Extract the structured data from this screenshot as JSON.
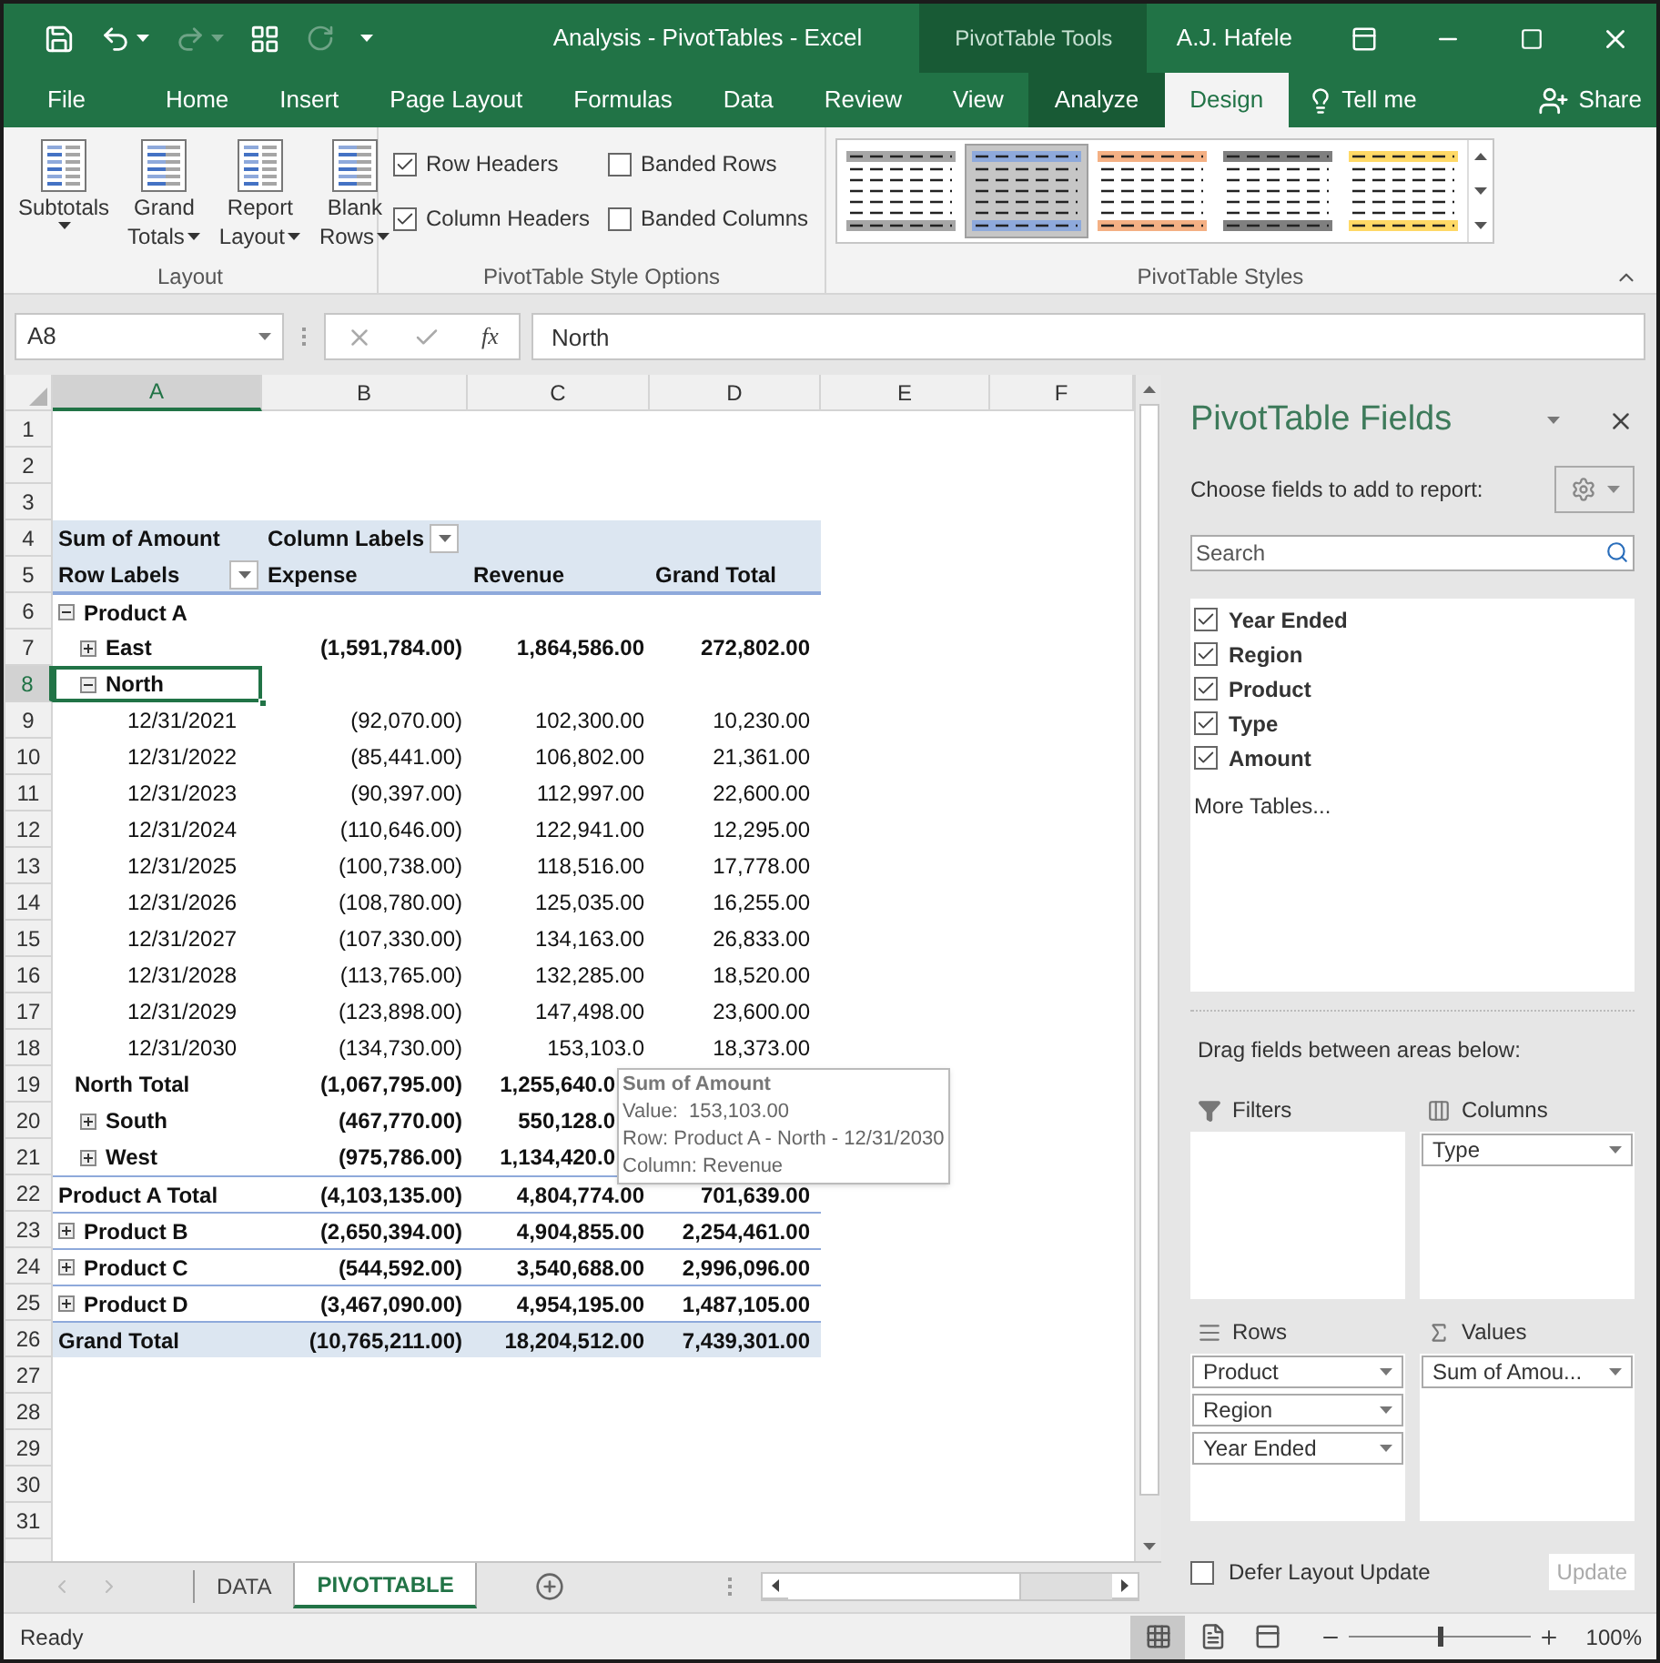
{
  "window": {
    "title": "Analysis - PivotTables  -  Excel",
    "context_group": "PivotTable Tools",
    "user": "A.J. Hafele"
  },
  "quick_access": [
    {
      "kind": "save",
      "disabled": false
    },
    {
      "kind": "undo",
      "disabled": false
    },
    {
      "kind": "redo",
      "disabled": true
    },
    {
      "kind": "form",
      "disabled": false
    },
    {
      "kind": "refresh",
      "disabled": true
    },
    {
      "kind": "customize",
      "disabled": false
    }
  ],
  "ribbon_tabs": [
    {
      "label": "File",
      "selected": false
    },
    {
      "label": "Home",
      "selected": false
    },
    {
      "label": "Insert",
      "selected": false
    },
    {
      "label": "Page Layout",
      "selected": false
    },
    {
      "label": "Formulas",
      "selected": false
    },
    {
      "label": "Data",
      "selected": false
    },
    {
      "label": "Review",
      "selected": false
    },
    {
      "label": "View",
      "selected": false
    }
  ],
  "context_tabs": [
    {
      "label": "Analyze",
      "selected": false
    },
    {
      "label": "Design",
      "selected": true
    }
  ],
  "tell_me": "Tell me",
  "share": "Share",
  "layout_group": {
    "label": "Layout",
    "buttons": [
      {
        "lines": [
          "Subtotals"
        ]
      },
      {
        "lines": [
          "Grand",
          "Totals"
        ]
      },
      {
        "lines": [
          "Report",
          "Layout"
        ]
      },
      {
        "lines": [
          "Blank",
          "Rows"
        ]
      }
    ]
  },
  "style_options": {
    "label": "PivotTable Style Options",
    "options": [
      {
        "label": "Row Headers",
        "checked": true
      },
      {
        "label": "Banded Rows",
        "checked": false
      },
      {
        "label": "Column Headers",
        "checked": true
      },
      {
        "label": "Banded Columns",
        "checked": false
      }
    ]
  },
  "styles": {
    "label": "PivotTable Styles",
    "swatches": [
      {
        "color": "#a6a6a6",
        "selected": false
      },
      {
        "color": "#8ea9db",
        "selected": true
      },
      {
        "color": "#f4b084",
        "selected": false
      },
      {
        "color": "#7f7f7f",
        "selected": false
      },
      {
        "color": "#ffd966",
        "selected": false
      }
    ]
  },
  "formula_bar": {
    "name_box": "A8",
    "function_label": "fx",
    "value": "North"
  },
  "columns": [
    {
      "label": "A",
      "selected": true
    },
    {
      "label": "B",
      "selected": false
    },
    {
      "label": "C",
      "selected": false
    },
    {
      "label": "D",
      "selected": false
    },
    {
      "label": "E",
      "selected": false
    },
    {
      "label": "F",
      "selected": false
    }
  ],
  "rows": [
    {
      "num": "1",
      "kind": "blank",
      "selected": false
    },
    {
      "num": "2",
      "kind": "blank",
      "selected": false
    },
    {
      "num": "3",
      "kind": "blank",
      "selected": false
    },
    {
      "num": "4",
      "kind": "header_top",
      "selected": false,
      "a": "Sum of Amount",
      "b": "Column Labels"
    },
    {
      "num": "5",
      "kind": "header",
      "selected": false,
      "a": "Row Labels",
      "b": "Expense",
      "c": "Revenue",
      "d": "Grand Total"
    },
    {
      "num": "6",
      "kind": "product",
      "selected": false,
      "expanded": true,
      "a": "Product A"
    },
    {
      "num": "7",
      "kind": "region",
      "selected": false,
      "expanded": false,
      "a": "East",
      "b": "(1,591,784.00)",
      "c": "1,864,586.00",
      "d": "272,802.00"
    },
    {
      "num": "8",
      "kind": "region",
      "selected": true,
      "expanded": true,
      "a": "North"
    },
    {
      "num": "9",
      "kind": "date",
      "selected": false,
      "a": "12/31/2021",
      "b": "(92,070.00)",
      "c": "102,300.00",
      "d": "10,230.00"
    },
    {
      "num": "10",
      "kind": "date",
      "selected": false,
      "a": "12/31/2022",
      "b": "(85,441.00)",
      "c": "106,802.00",
      "d": "21,361.00"
    },
    {
      "num": "11",
      "kind": "date",
      "selected": false,
      "a": "12/31/2023",
      "b": "(90,397.00)",
      "c": "112,997.00",
      "d": "22,600.00"
    },
    {
      "num": "12",
      "kind": "date",
      "selected": false,
      "a": "12/31/2024",
      "b": "(110,646.00)",
      "c": "122,941.00",
      "d": "12,295.00"
    },
    {
      "num": "13",
      "kind": "date",
      "selected": false,
      "a": "12/31/2025",
      "b": "(100,738.00)",
      "c": "118,516.00",
      "d": "17,778.00"
    },
    {
      "num": "14",
      "kind": "date",
      "selected": false,
      "a": "12/31/2026",
      "b": "(108,780.00)",
      "c": "125,035.00",
      "d": "16,255.00"
    },
    {
      "num": "15",
      "kind": "date",
      "selected": false,
      "a": "12/31/2027",
      "b": "(107,330.00)",
      "c": "134,163.00",
      "d": "26,833.00"
    },
    {
      "num": "16",
      "kind": "date",
      "selected": false,
      "a": "12/31/2028",
      "b": "(113,765.00)",
      "c": "132,285.00",
      "d": "18,520.00"
    },
    {
      "num": "17",
      "kind": "date",
      "selected": false,
      "a": "12/31/2029",
      "b": "(123,898.00)",
      "c": "147,498.00",
      "d": "23,600.00"
    },
    {
      "num": "18",
      "kind": "date",
      "selected": false,
      "a": "12/31/2030",
      "b": "(134,730.00)",
      "c": "153,103.0",
      "d": "18,373.00"
    },
    {
      "num": "19",
      "kind": "region_total",
      "selected": false,
      "a": "North Total",
      "b": "(1,067,795.00)",
      "c": "1,255,640.0"
    },
    {
      "num": "20",
      "kind": "region",
      "selected": false,
      "expanded": false,
      "a": "South",
      "b": "(467,770.00)",
      "c": "550,128.0"
    },
    {
      "num": "21",
      "kind": "region",
      "selected": false,
      "expanded": false,
      "a": "West",
      "b": "(975,786.00)",
      "c": "1,134,420.0"
    },
    {
      "num": "22",
      "kind": "product_total",
      "selected": false,
      "a": "Product A Total",
      "b": "(4,103,135.00)",
      "c": "4,804,774.00",
      "d": "701,639.00"
    },
    {
      "num": "23",
      "kind": "product",
      "selected": false,
      "expanded": false,
      "a": "Product B",
      "b": "(2,650,394.00)",
      "c": "4,904,855.00",
      "d": "2,254,461.00"
    },
    {
      "num": "24",
      "kind": "product",
      "selected": false,
      "expanded": false,
      "a": "Product C",
      "b": "(544,592.00)",
      "c": "3,540,688.00",
      "d": "2,996,096.00"
    },
    {
      "num": "25",
      "kind": "product",
      "selected": false,
      "expanded": false,
      "a": "Product D",
      "b": "(3,467,090.00)",
      "c": "4,954,195.00",
      "d": "1,487,105.00"
    },
    {
      "num": "26",
      "kind": "grand_total",
      "selected": false,
      "a": "Grand Total",
      "b": "(10,765,211.00)",
      "c": "18,204,512.00",
      "d": "7,439,301.00"
    },
    {
      "num": "27",
      "kind": "blank",
      "selected": false
    },
    {
      "num": "28",
      "kind": "blank",
      "selected": false
    },
    {
      "num": "29",
      "kind": "blank",
      "selected": false
    },
    {
      "num": "30",
      "kind": "blank",
      "selected": false
    },
    {
      "num": "31",
      "kind": "blank",
      "selected": false
    }
  ],
  "tooltip": {
    "title": "Sum of Amount",
    "lines": [
      "Value:  153,103.00",
      "Row: Product A - North - 12/31/2030",
      "Column: Revenue"
    ]
  },
  "field_list": {
    "title": "PivotTable Fields",
    "prompt": "Choose fields to add to report:",
    "search": {
      "placeholder": "Search"
    },
    "fields": [
      {
        "label": "Year Ended",
        "checked": true
      },
      {
        "label": "Region",
        "checked": true
      },
      {
        "label": "Product",
        "checked": true
      },
      {
        "label": "Type",
        "checked": true
      },
      {
        "label": "Amount",
        "checked": true
      }
    ],
    "more_tables": "More Tables...",
    "drag_hint": "Drag fields between areas below:",
    "areas": [
      {
        "kind": "filters",
        "label": "Filters"
      },
      {
        "kind": "columns",
        "label": "Columns",
        "items": [
          "Type"
        ]
      },
      {
        "kind": "rows",
        "label": "Rows",
        "items": [
          "Product",
          "Region",
          "Year Ended"
        ]
      },
      {
        "kind": "values",
        "label": "Values",
        "items": [
          "Sum of Amou..."
        ]
      }
    ],
    "defer": {
      "label": "Defer Layout Update",
      "checked": false
    },
    "update": {
      "label": "Update",
      "disabled": true
    }
  },
  "sheet_tabs": [
    {
      "label": "DATA",
      "selected": false
    },
    {
      "label": "PIVOTTABLE",
      "selected": true
    }
  ],
  "status_bar": {
    "text": "Ready",
    "views": [
      {
        "kind": "normal",
        "selected": true
      },
      {
        "kind": "page_layout",
        "selected": false
      },
      {
        "kind": "page_break",
        "selected": false
      }
    ],
    "zoom": {
      "level": 0.5,
      "reading": "100%"
    }
  }
}
